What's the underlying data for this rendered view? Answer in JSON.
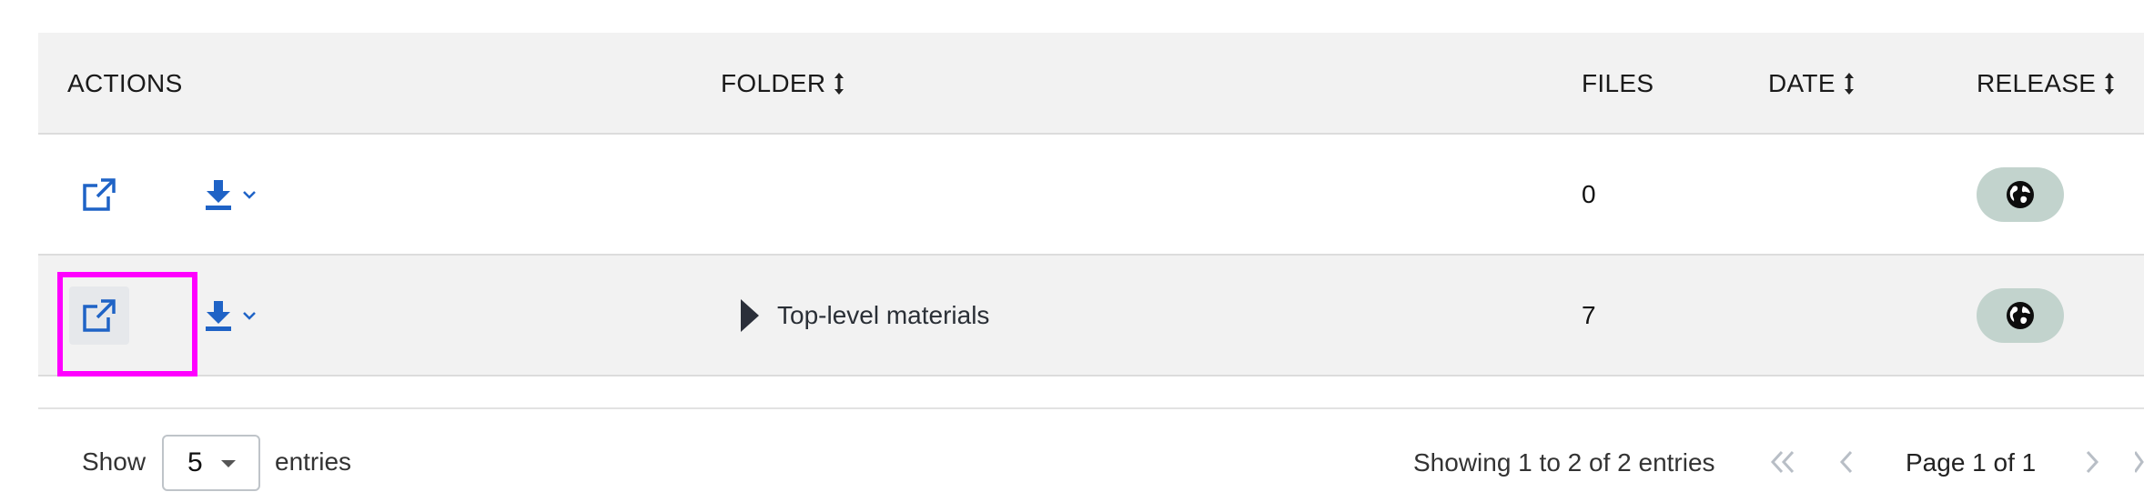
{
  "table": {
    "headers": {
      "actions": "ACTIONS",
      "folder": "FOLDER",
      "files": "FILES",
      "date": "DATE",
      "release": "RELEASE"
    },
    "rows": [
      {
        "folder": "",
        "files": "0",
        "date": "",
        "release_icon": "globe-icon"
      },
      {
        "folder": "Top-level materials",
        "files": "7",
        "date": "",
        "release_icon": "globe-icon"
      }
    ]
  },
  "footer": {
    "show_label": "Show",
    "page_size": "5",
    "entries_label": "entries",
    "showing_text": "Showing 1 to 2 of 2 entries",
    "page_info": "Page 1 of 1"
  },
  "colors": {
    "accent_blue": "#1f63c6",
    "highlight": "#ff00ff",
    "badge_bg": "#c2d3cd",
    "header_bg": "#f2f2f2"
  }
}
